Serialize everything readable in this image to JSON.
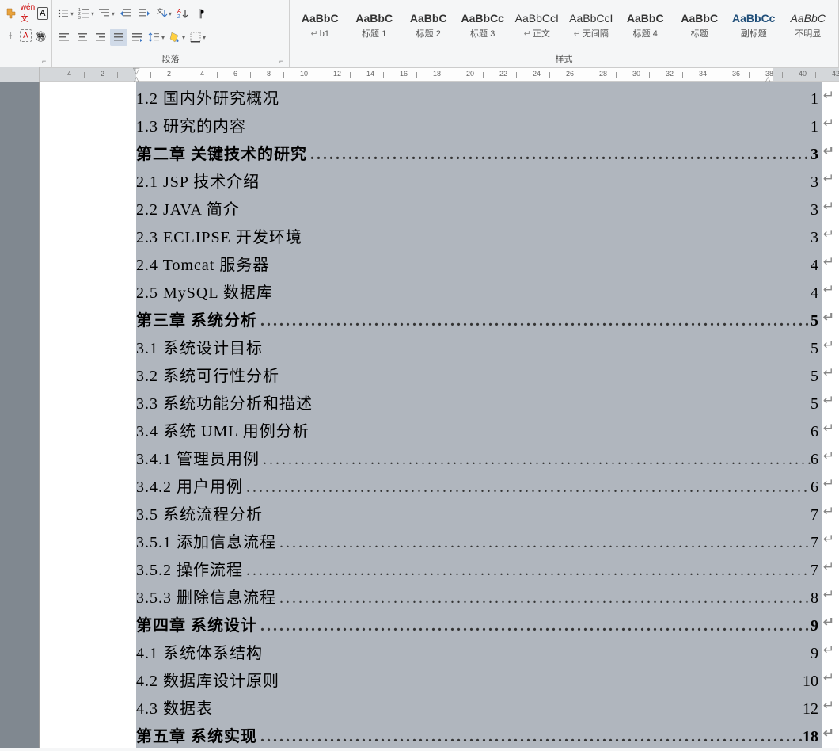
{
  "groups": {
    "paragraph_label": "段落",
    "styles_label": "样式"
  },
  "styles": [
    {
      "sample": "AaBbC",
      "name": "b1",
      "prefix": "↵",
      "bold": true
    },
    {
      "sample": "AaBbC",
      "name": "标题 1",
      "bold": true
    },
    {
      "sample": "AaBbC",
      "name": "标题 2",
      "bold": true
    },
    {
      "sample": "AaBbCc",
      "name": "标题 3",
      "bold": true
    },
    {
      "sample": "AaBbCcI",
      "name": "正文",
      "prefix": "↵"
    },
    {
      "sample": "AaBbCcI",
      "name": "无间隔",
      "prefix": "↵"
    },
    {
      "sample": "AaBbC",
      "name": "标题 4",
      "bold": true
    },
    {
      "sample": "AaBbC",
      "name": "标题",
      "bold": true
    },
    {
      "sample": "AaBbCc",
      "name": "副标题",
      "bold": true,
      "blue": true
    },
    {
      "sample": "AaBbC",
      "name": "不明显",
      "ital": true
    }
  ],
  "ruler": {
    "marks": [
      "4",
      "2",
      "",
      "2",
      "4",
      "6",
      "8",
      "10",
      "12",
      "14",
      "16",
      "18",
      "20",
      "22",
      "24",
      "26",
      "28",
      "30",
      "32",
      "34",
      "36",
      "38",
      "40",
      "42"
    ]
  },
  "toc": [
    {
      "text": "1.2 国内外研究概况",
      "page": "1",
      "chapter": false,
      "nodots": true
    },
    {
      "text": "1.3 研究的内容",
      "page": "1",
      "chapter": false,
      "nodots": true
    },
    {
      "text": "第二章 关键技术的研究",
      "page": "3",
      "chapter": true
    },
    {
      "text": "2.1 JSP 技术介绍",
      "page": "3",
      "chapter": false,
      "nodots": true
    },
    {
      "text": "2.2 JAVA 简介",
      "page": "3",
      "chapter": false,
      "nodots": true
    },
    {
      "text": "2.3 ECLIPSE 开发环境",
      "page": "3",
      "chapter": false,
      "nodots": true
    },
    {
      "text": "2.4 Tomcat 服务器",
      "page": "4",
      "chapter": false,
      "nodots": true
    },
    {
      "text": "2.5 MySQL 数据库",
      "page": "4",
      "chapter": false,
      "nodots": true
    },
    {
      "text": "第三章 系统分析",
      "page": "5",
      "chapter": true
    },
    {
      "text": "3.1 系统设计目标",
      "page": "5",
      "chapter": false,
      "nodots": true
    },
    {
      "text": "3.2 系统可行性分析",
      "page": "5",
      "chapter": false,
      "nodots": true
    },
    {
      "text": "3.3 系统功能分析和描述",
      "page": "5",
      "chapter": false,
      "nodots": true
    },
    {
      "text": "3.4 系统 UML 用例分析",
      "page": "6",
      "chapter": false,
      "nodots": true
    },
    {
      "text": "3.4.1 管理员用例",
      "page": "6",
      "chapter": false
    },
    {
      "text": "3.4.2 用户用例",
      "page": "6",
      "chapter": false
    },
    {
      "text": "3.5 系统流程分析",
      "page": "7",
      "chapter": false,
      "nodots": true
    },
    {
      "text": "3.5.1 添加信息流程",
      "page": "7",
      "chapter": false
    },
    {
      "text": "3.5.2 操作流程",
      "page": "7",
      "chapter": false
    },
    {
      "text": "3.5.3 删除信息流程",
      "page": "8",
      "chapter": false
    },
    {
      "text": "第四章 系统设计",
      "page": "9",
      "chapter": true
    },
    {
      "text": "4.1 系统体系结构",
      "page": "9",
      "chapter": false,
      "nodots": true
    },
    {
      "text": "4.2 数据库设计原则",
      "page": "10",
      "chapter": false,
      "nodots": true
    },
    {
      "text": "4.3 数据表",
      "page": "12",
      "chapter": false,
      "nodots": true
    },
    {
      "text": "第五章 系统实现",
      "page": "18",
      "chapter": true
    }
  ]
}
